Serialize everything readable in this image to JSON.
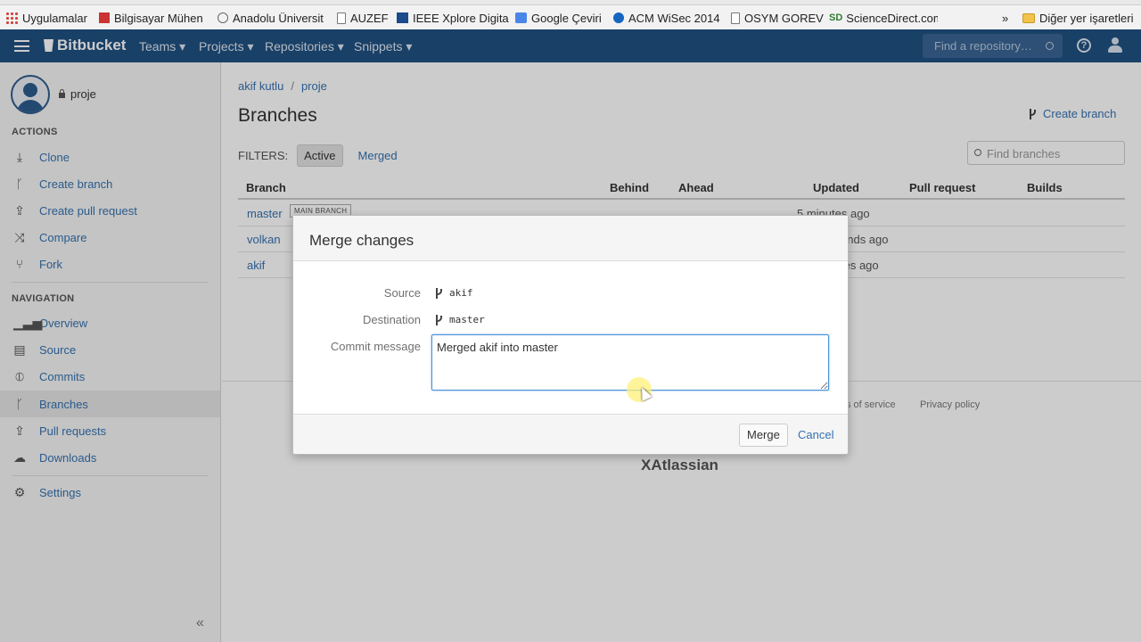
{
  "bookmarks": [
    {
      "label": "Uygulamalar",
      "icon": "apps-grid-icon"
    },
    {
      "label": "Bilgisayar Mühen",
      "icon": "university-icon"
    },
    {
      "label": "Anadolu Üniversit",
      "icon": "anadolu-icon"
    },
    {
      "label": "AUZEF",
      "icon": "page-icon"
    },
    {
      "label": "IEEE Xplore Digita",
      "icon": "ieee-icon"
    },
    {
      "label": "Google Çeviri",
      "icon": "google-translate-icon"
    },
    {
      "label": "ACM WiSec 2014",
      "icon": "acm-icon"
    },
    {
      "label": "OSYM GOREV",
      "icon": "page-icon"
    },
    {
      "label": "ScienceDirect.com",
      "icon": "sciencedirect-icon"
    },
    {
      "label": "»",
      "icon": "overflow-icon"
    },
    {
      "label": "Diğer yer işaretleri",
      "icon": "folder-icon"
    }
  ],
  "header": {
    "brand": "Bitbucket",
    "menus": [
      "Teams ▾",
      "Projects ▾",
      "Repositories ▾",
      "Snippets ▾"
    ],
    "search_placeholder": "Find a repository…",
    "help": "?"
  },
  "sidebar": {
    "repo_name": "proje",
    "actions_heading": "ACTIONS",
    "actions": [
      {
        "label": "Clone",
        "icon": "download-icon"
      },
      {
        "label": "Create branch",
        "icon": "branch-icon"
      },
      {
        "label": "Create pull request",
        "icon": "pull-request-icon"
      },
      {
        "label": "Compare",
        "icon": "compare-icon"
      },
      {
        "label": "Fork",
        "icon": "fork-icon"
      }
    ],
    "navigation_heading": "NAVIGATION",
    "navigation": [
      {
        "label": "Overview",
        "icon": "overview-icon"
      },
      {
        "label": "Source",
        "icon": "source-icon"
      },
      {
        "label": "Commits",
        "icon": "commits-icon"
      },
      {
        "label": "Branches",
        "icon": "branch-icon"
      },
      {
        "label": "Pull requests",
        "icon": "pull-request-icon"
      },
      {
        "label": "Downloads",
        "icon": "cloud-download-icon"
      }
    ],
    "settings": {
      "label": "Settings",
      "icon": "gear-icon"
    },
    "collapse": "«"
  },
  "main": {
    "breadcrumb": [
      "akif kutlu",
      "proje"
    ],
    "breadcrumb_sep": "/",
    "title": "Branches",
    "create_branch": "Create branch",
    "filters_label": "FILTERS:",
    "filter_active": "Active",
    "filter_merged": "Merged",
    "find_placeholder": "Find branches",
    "columns": [
      "Branch",
      "Behind",
      "Ahead",
      "Updated",
      "Pull request",
      "Builds"
    ],
    "rows": [
      {
        "branch": "master",
        "tag": "MAIN BRANCH",
        "updated": "5 minutes ago"
      },
      {
        "branch": "volkan",
        "tag": "",
        "updated": "onds ago"
      },
      {
        "branch": "akif",
        "tag": "",
        "updated": "tes ago"
      }
    ],
    "footer_links": [
      "s of service",
      "Privacy policy"
    ],
    "atlassian": "Atlassian"
  },
  "dialog": {
    "title": "Merge changes",
    "source_label": "Source",
    "source_value": "akif",
    "destination_label": "Destination",
    "destination_value": "master",
    "commit_label": "Commit message",
    "commit_value": "Merged akif into master",
    "merge_button": "Merge",
    "cancel_link": "Cancel"
  },
  "colors": {
    "header_bg": "#205081",
    "link": "#3572b0",
    "input_focus": "#4a90d9"
  }
}
